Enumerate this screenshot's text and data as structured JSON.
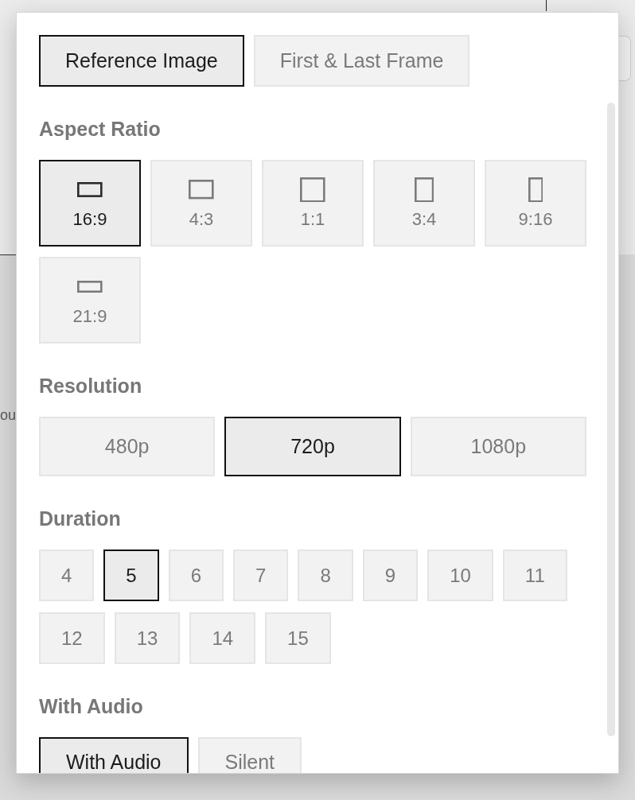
{
  "background": {
    "text_fragment": "ou"
  },
  "panel": {
    "mode_tabs": [
      {
        "label": "Reference Image",
        "selected": true
      },
      {
        "label": "First & Last Frame",
        "selected": false
      }
    ],
    "sections": [
      {
        "kind": "aspect",
        "title": "Aspect Ratio",
        "options": [
          {
            "label": "16:9",
            "selected": true
          },
          {
            "label": "4:3",
            "selected": false
          },
          {
            "label": "1:1",
            "selected": false
          },
          {
            "label": "3:4",
            "selected": false
          },
          {
            "label": "9:16",
            "selected": false
          },
          {
            "label": "21:9",
            "selected": false
          }
        ]
      },
      {
        "kind": "resolution",
        "title": "Resolution",
        "options": [
          {
            "label": "480p",
            "selected": false
          },
          {
            "label": "720p",
            "selected": true
          },
          {
            "label": "1080p",
            "selected": false
          }
        ]
      },
      {
        "kind": "duration",
        "title": "Duration",
        "options": [
          {
            "label": "4",
            "selected": false
          },
          {
            "label": "5",
            "selected": true
          },
          {
            "label": "6",
            "selected": false
          },
          {
            "label": "7",
            "selected": false
          },
          {
            "label": "8",
            "selected": false
          },
          {
            "label": "9",
            "selected": false
          },
          {
            "label": "10",
            "selected": false
          },
          {
            "label": "11",
            "selected": false
          },
          {
            "label": "12",
            "selected": false
          },
          {
            "label": "13",
            "selected": false
          },
          {
            "label": "14",
            "selected": false
          },
          {
            "label": "15",
            "selected": false
          }
        ]
      },
      {
        "kind": "audio",
        "title": "With Audio",
        "options": [
          {
            "label": "With Audio",
            "selected": true
          },
          {
            "label": "Silent",
            "selected": false
          }
        ]
      }
    ]
  }
}
